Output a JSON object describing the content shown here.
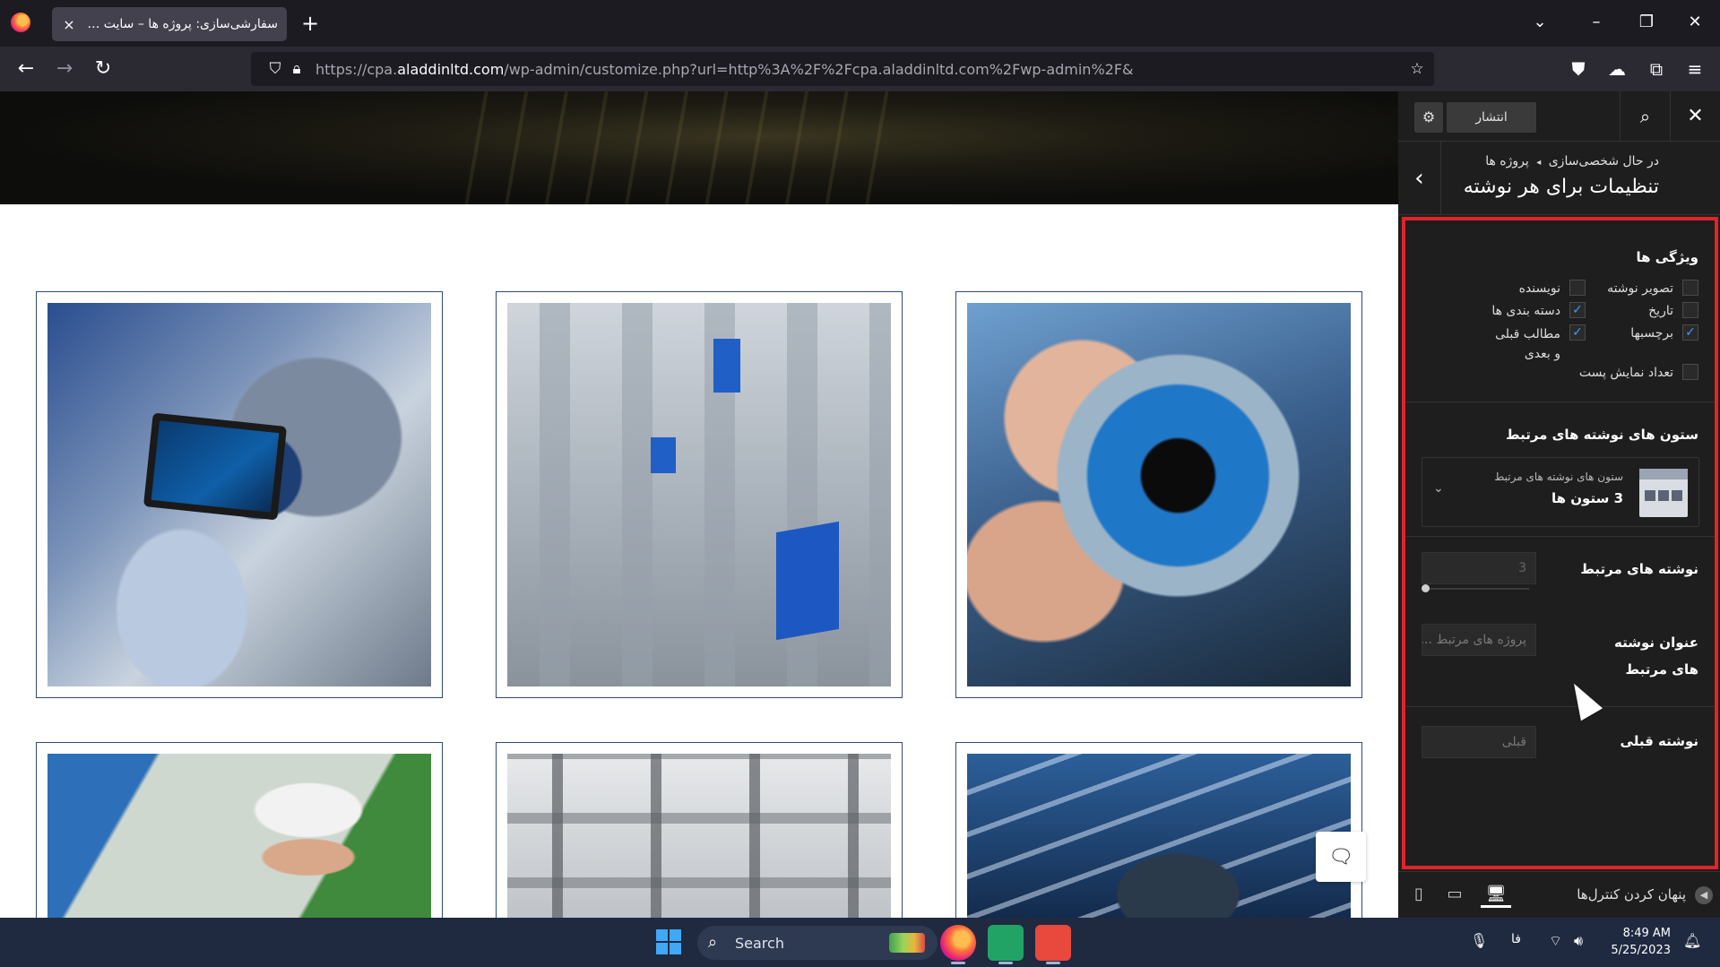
{
  "browser": {
    "tab_title": "سفارشی‌سازی: پروژه ها – سایت آزمایشی",
    "tab_close": "×",
    "new_tab": "+",
    "url_prefix": "https://cpa.",
    "url_domain": "aladdinltd.com",
    "url_suffix": "/wp-admin/customize.php?url=http%3A%2F%2Fcpa.aladdinltd.com%2Fwp-admin%2F&"
  },
  "customizer": {
    "publish_label": "انتشار",
    "breadcrumb_prefix": "در حال شخصی‌سازی",
    "breadcrumb_sep": "◂",
    "breadcrumb_section": "پروژه ها",
    "panel_title": "تنظیمات برای هر نوشته",
    "features": {
      "title": "ویژگی ها",
      "items": [
        {
          "label": "تصویر نوشته",
          "checked": false
        },
        {
          "label": "نویسنده",
          "checked": false
        },
        {
          "label": "تاریخ",
          "checked": false
        },
        {
          "label": "دسته بندی ها",
          "checked": true
        },
        {
          "label": "برچسبها",
          "checked": true
        },
        {
          "label": "مطالب قبلی و بعدی",
          "checked": true
        },
        {
          "label": "تعداد نمایش پست",
          "checked": false
        }
      ]
    },
    "related_columns": {
      "title": "ستون های نوشته های مرتبط",
      "control_label": "ستون های نوشته های مرتبط",
      "control_value": "3 ستون ها"
    },
    "related_posts": {
      "title": "نوشته های مرتبط",
      "value": "3"
    },
    "related_title": {
      "title": "عنوان نوشته های مرتبط",
      "placeholder": "پروژه های مرتبط ..."
    },
    "previous_post": {
      "title": "نوشته قبلی",
      "placeholder": "قبلی"
    },
    "footer": {
      "hide_controls": "پنهان کردن کنترل‌ها"
    }
  },
  "taskbar": {
    "search_label": "Search",
    "lang": "فا",
    "time": "8:49 AM",
    "date": "5/25/2023"
  },
  "colors": {
    "highlight_border": "#e0242b",
    "card_border": "#2e4a77",
    "checkbox_check": "#3b9cff"
  }
}
